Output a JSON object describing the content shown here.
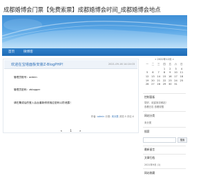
{
  "site": {
    "title": "成都婚博会门票【免费索票】成都婚博会时间_成都婚博会地点"
  },
  "nav": {
    "items": [
      "首页",
      "微博客"
    ]
  },
  "post": {
    "title": "欢迎在宝塔面板安装Z-BlogPHP！",
    "date": "2021-09-16 14:10:03",
    "lines": [
      "管理员账号：admin",
      "管理员密码：zblogger",
      "请在集成后的登入后台重新修改相应密码以防泄露！"
    ],
    "meta": {
      "author_prefix": "作者:",
      "author": "admin",
      "category_prefix": "分类:",
      "category": "未分类",
      "views": "浏览:5",
      "comments": "评论:0"
    }
  },
  "pager": {
    "prev": "«",
    "current": "1",
    "next": "»"
  },
  "sidebar": {
    "calendar": {
      "header": "«   2022年12月   »",
      "weekdays": [
        "一",
        "二",
        "三",
        "四",
        "五",
        "六",
        "日"
      ],
      "days": [
        "",
        "",
        "",
        "1",
        "2",
        "3",
        "4",
        "5",
        "6",
        "7",
        "8",
        "9",
        "10",
        "11",
        "12",
        "13",
        "14",
        "15",
        "16",
        "17",
        "18",
        "19",
        "20",
        "21",
        "22",
        "23",
        "24",
        "25",
        "26",
        "27",
        "28",
        "29",
        "30",
        "31",
        ""
      ]
    },
    "widgets": [
      {
        "title": "控制面板",
        "text": "您好，欢迎到访网站！"
      },
      {
        "title": "",
        "text": "查看日志  查看权限"
      },
      {
        "title": "网站分类",
        "text": "未分类"
      },
      {
        "title": "搜索",
        "text": ""
      },
      {
        "title": "最新留言",
        "text": ""
      },
      {
        "title": "文章归档",
        "text": "2021年9月 (1)"
      },
      {
        "title": "网站收藏",
        "text": ""
      }
    ],
    "search_button": "搜索"
  }
}
